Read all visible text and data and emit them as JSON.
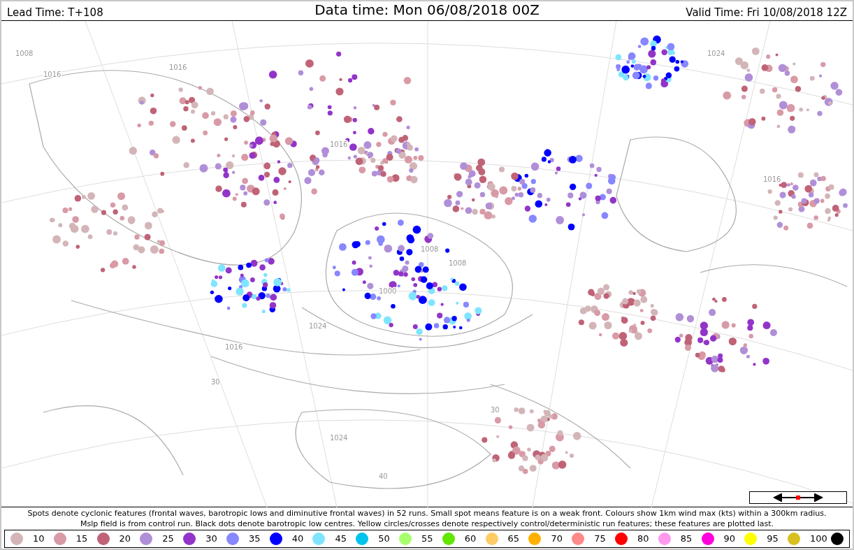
{
  "header": {
    "lead_time": "Lead Time: T+108",
    "data_time": "Data time:  Mon 06/08/2018 00Z",
    "valid_time": "Valid Time: Fri 10/08/2018 12Z"
  },
  "map": {
    "isobar_labels": [
      "1008",
      "1016",
      "1016",
      "1024",
      "1016",
      "1024",
      "1016",
      "1000",
      "1008",
      "1016",
      "1024",
      "1008",
      "30",
      "40",
      "30"
    ]
  },
  "caption": [
    "Spots denote cyclonic features (frontal waves, barotropic lows and diminutive frontal waves) in 52 runs. Small spot means feature is on a weak front. Colours show 1km wind max (kts) within a 300km radius.",
    "Mslp field is from control run. Black dots denote barotropic low centres. Yellow circles/crosses denote respectively control/deterministic run features; these features are plotted last."
  ],
  "legend": [
    {
      "label": "10",
      "color": "#d3b5b8"
    },
    {
      "label": "15",
      "color": "#d89aa6"
    },
    {
      "label": "20",
      "color": "#c06377"
    },
    {
      "label": "25",
      "color": "#b08fd8"
    },
    {
      "label": "30",
      "color": "#9334c8"
    },
    {
      "label": "35",
      "color": "#8787ff"
    },
    {
      "label": "40",
      "color": "#0000ff"
    },
    {
      "label": "45",
      "color": "#7fe5ff"
    },
    {
      "label": "50",
      "color": "#00c4ee"
    },
    {
      "label": "55",
      "color": "#a8ff6e"
    },
    {
      "label": "60",
      "color": "#62e600"
    },
    {
      "label": "65",
      "color": "#ffcc66"
    },
    {
      "label": "70",
      "color": "#ffb000"
    },
    {
      "label": "75",
      "color": "#ff8a8a"
    },
    {
      "label": "80",
      "color": "#ff0000"
    },
    {
      "label": "85",
      "color": "#ff99ee"
    },
    {
      "label": "90",
      "color": "#ff00dd"
    },
    {
      "label": "95",
      "color": "#ffff00"
    },
    {
      "label": "100",
      "color": "#d8c020"
    },
    {
      "color": "#000000"
    }
  ]
}
